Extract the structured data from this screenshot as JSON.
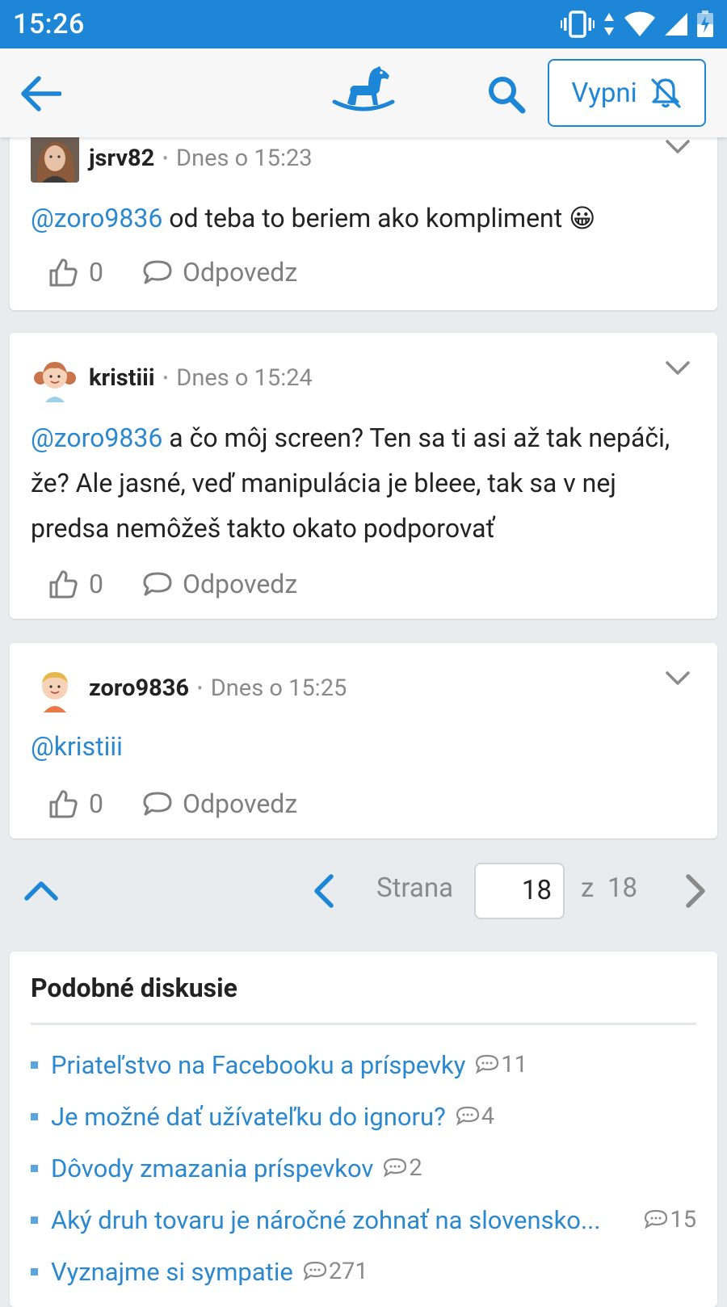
{
  "status_bar": {
    "time": "15:26"
  },
  "app_bar": {
    "mute_label": "Vypni"
  },
  "posts": [
    {
      "author": "jsrv82",
      "time": "Dnes o 15:23",
      "mention": "@zoro9836",
      "text": " od teba to beriem ako kompliment 😀",
      "likes": "0",
      "reply_label": "Odpovedz"
    },
    {
      "author": "kristiii",
      "time": "Dnes o 15:24",
      "mention": "@zoro9836",
      "text": " a čo môj screen? Ten sa ti asi až tak nepáči, že? Ale jasné, veď manipulácia je bleee, tak sa v nej predsa nemôžeš takto okato podporovať",
      "likes": "0",
      "reply_label": "Odpovedz"
    },
    {
      "author": "zoro9836",
      "time": "Dnes o 15:25",
      "mention": "@kristiii",
      "text": "",
      "likes": "0",
      "reply_label": "Odpovedz"
    }
  ],
  "pagination": {
    "label": "Strana",
    "current": "18",
    "of_label": "z",
    "total": "18"
  },
  "similar": {
    "title": "Podobné diskusie",
    "items": [
      {
        "title": "Priateľstvo na Facebooku a príspevky",
        "count": "11"
      },
      {
        "title": "Je možné dať užívateľku do ignoru?",
        "count": "4"
      },
      {
        "title": "Dôvody zmazania príspevkov",
        "count": "2"
      },
      {
        "title": "Aký druh tovaru je náročné zohnať na slovensko...",
        "count": "15"
      },
      {
        "title": "Vyznajme si sympatie",
        "count": "271"
      }
    ]
  },
  "colors": {
    "primary": "#1e86d6",
    "link": "#2a88d1",
    "muted": "#8a8a8a",
    "background": "#e9ecef"
  }
}
